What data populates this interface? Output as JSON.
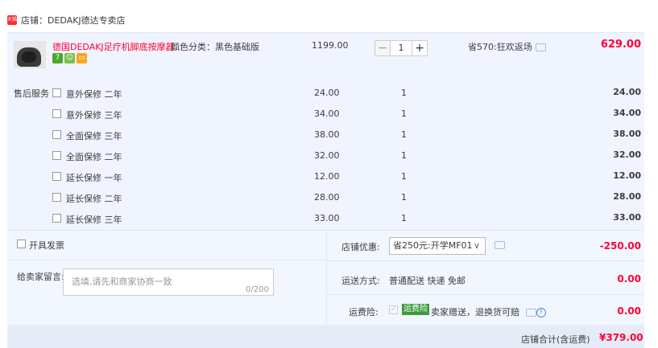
{
  "shop": {
    "badge": "天猫",
    "name": "店铺：DEDAKJ德达专卖店"
  },
  "item": {
    "title": "德国DEDAKJ足疗机脚底按摩器...",
    "sku_label": "颜色分类：",
    "sku_value": "黑色基础版",
    "price": "1199.00",
    "qty": "1",
    "minus": "−",
    "plus": "+",
    "promo": "省570:狂欢返场",
    "total": "629.00",
    "badges": [
      {
        "text": "7",
        "color": "#4aa92a"
      },
      {
        "text": "☺",
        "color": "#7ac143"
      },
      {
        "text": "▭",
        "color": "#f5a623"
      }
    ]
  },
  "service": {
    "label": "售后服务",
    "rows": [
      {
        "name": "意外保修 二年",
        "price": "24.00",
        "qty": "1",
        "total": "24.00"
      },
      {
        "name": "意外保修 三年",
        "price": "34.00",
        "qty": "1",
        "total": "34.00"
      },
      {
        "name": "全面保修 三年",
        "price": "38.00",
        "qty": "1",
        "total": "38.00"
      },
      {
        "name": "全面保修 二年",
        "price": "32.00",
        "qty": "1",
        "total": "32.00"
      },
      {
        "name": "延长保修 一年",
        "price": "12.00",
        "qty": "1",
        "total": "12.00"
      },
      {
        "name": "延长保修 二年",
        "price": "28.00",
        "qty": "1",
        "total": "28.00"
      },
      {
        "name": "延长保修 三年",
        "price": "33.00",
        "qty": "1",
        "total": "33.00"
      }
    ]
  },
  "invoice": {
    "label": "开具发票"
  },
  "note": {
    "label": "给卖家留言:",
    "placeholder": "选填,请先和商家协商一致",
    "count": "0/200"
  },
  "coupon": {
    "label": "店铺优惠:",
    "selected": "省250元:开学MF01",
    "amount": "-250.00"
  },
  "shipping": {
    "label": "运送方式:",
    "value": "普通配送 快递 免邮",
    "amount": "0.00"
  },
  "insurance": {
    "label": "运费险:",
    "tag": "运费险",
    "text": "卖家赠送，退换货可赔",
    "amount": "0.00"
  },
  "footer": {
    "label": "店铺合计(含运费)",
    "amount": "¥379.00"
  }
}
